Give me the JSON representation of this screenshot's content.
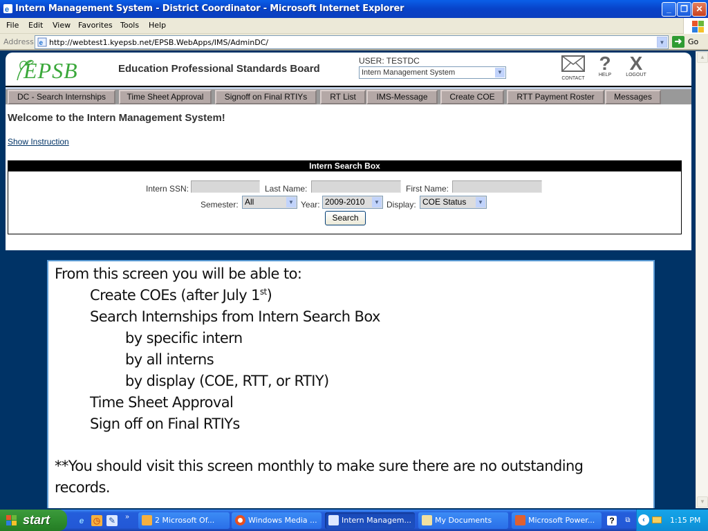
{
  "window": {
    "title": "Intern Management System - District Coordinator - Microsoft Internet Explorer",
    "controls": {
      "minimize": "_",
      "restore": "❐",
      "close": "✕"
    }
  },
  "menubar": {
    "items": [
      "File",
      "Edit",
      "View",
      "Favorites",
      "Tools",
      "Help"
    ]
  },
  "addressbar": {
    "label": "Address",
    "url": "http://webtest1.kyepsb.net/EPSB.WebApps/IMS/AdminDC/",
    "go_label": "Go"
  },
  "header": {
    "logo_text": "EPSB",
    "org_name": "Education Professional Standards Board",
    "user_label": "USER: TESTDC",
    "system_select": "Intern Management System",
    "icons": [
      {
        "name": "contact",
        "label": "CONTACT"
      },
      {
        "name": "help",
        "label": "HELP"
      },
      {
        "name": "logout",
        "label": "LOGOUT"
      }
    ]
  },
  "tabs": [
    "DC - Search Internships",
    "Time Sheet Approval",
    "Signoff on Final RTIYs",
    "RT List",
    "IMS-Message",
    "Create COE",
    "RTT Payment Roster",
    "Messages"
  ],
  "main": {
    "welcome": "Welcome to the Intern Management System!",
    "show_instruction": "Show Instruction"
  },
  "search_box": {
    "title": "Intern Search Box",
    "ssn_label": "Intern SSN:",
    "ssn_value": "",
    "last_name_label": "Last Name:",
    "last_name_value": "",
    "first_name_label": "First Name:",
    "first_name_value": "",
    "semester_label": "Semester:",
    "semester_value": "All",
    "year_label": "Year:",
    "year_value": "2009-2010",
    "display_label": "Display:",
    "display_value": "COE Status",
    "search_button": "Search"
  },
  "overlay": {
    "intro": "From this screen you will be able to:",
    "item1": "Create COEs (after July 1",
    "item1_sup": "st",
    "item1_end": ")",
    "item2": "Search Internships from Intern Search Box",
    "sub1": "by specific intern",
    "sub2": "by all interns",
    "sub3": "by display (COE, RTT, or RTIY)",
    "item3": "Time Sheet Approval",
    "item4": "Sign off on Final RTIYs",
    "note_line1": "**You should visit this screen monthly to make sure there are no outstanding",
    "note_line2": "records."
  },
  "taskbar": {
    "start_label": "start",
    "quicklaunch_more": "»",
    "buttons": [
      {
        "label": "2 Microsoft Of...",
        "active": false
      },
      {
        "label": "Windows Media ...",
        "active": false
      },
      {
        "label": "Intern Managem...",
        "active": true
      },
      {
        "label": "My Documents",
        "active": false
      },
      {
        "label": "Microsoft Power...",
        "active": false
      }
    ],
    "clock": "1:15 PM"
  },
  "colors": {
    "page_bg": "#003366",
    "logo_green": "#3aa83a",
    "tab_bg": "#b4a8a6",
    "overlay_border": "#5b9bd5"
  }
}
